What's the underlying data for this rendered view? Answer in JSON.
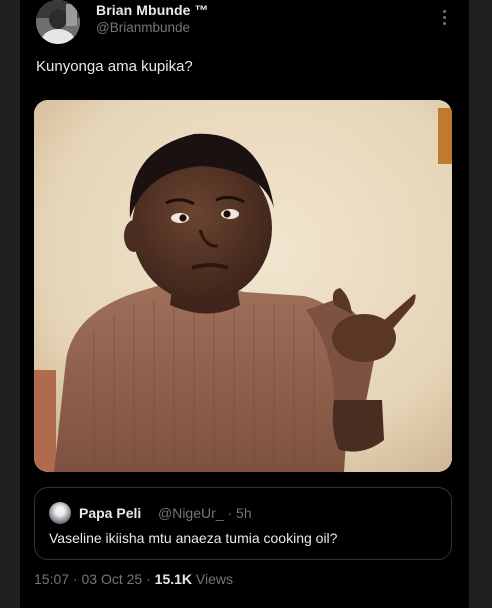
{
  "tweet": {
    "display_name": "Brian Mbunde ™",
    "handle": "@Brianmbunde",
    "text": "Kunyonga ama kupika?",
    "more_icon": "more-dots-icon"
  },
  "quote": {
    "display_name": "Papa Peli",
    "handle": "@NigeUr_",
    "separator": "·",
    "time": "5h",
    "text": "Vaseline ikiisha mtu anaeza tumia cooking oil?"
  },
  "meta": {
    "time": "15:07",
    "separator": "·",
    "date": "03 Oct 25",
    "views_count": "15.1K",
    "views_label": "Views"
  },
  "colors": {
    "background": "#000000",
    "text_primary": "#e7e9ea",
    "text_secondary": "#71767b",
    "border": "#2f3336"
  }
}
